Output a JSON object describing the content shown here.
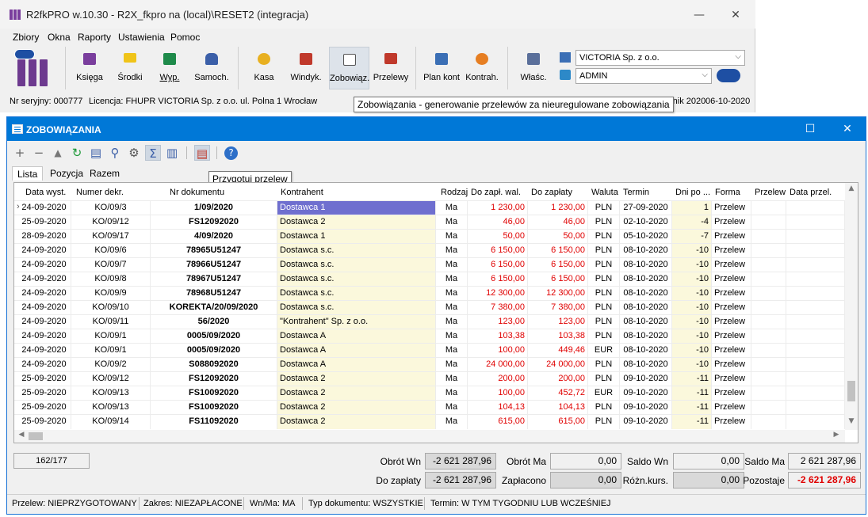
{
  "app": {
    "title": "R2fkPRO w.10.30 - R2X_fkpro na (local)\\RESET2 (integracja)",
    "minimize": "—",
    "close": "✕"
  },
  "menu": [
    "Zbiory",
    "Okna",
    "Raporty",
    "Ustawienia",
    "Pomoc"
  ],
  "toolbar": {
    "buttons": [
      "Księga",
      "Środki",
      "Wyp.",
      "Samoch.",
      "Kasa",
      "Windyk.",
      "Zobowiąz.",
      "Przelewy",
      "Plan kont",
      "Kontrah.",
      "Właśc."
    ],
    "company": "VICTORIA Sp. z o.o.",
    "user": "ADMIN",
    "combo_arrow": "⌵"
  },
  "statusline": {
    "serial": "Nr seryjny: 000777",
    "license": "Licencja: FHUPR VICTORIA Sp. z o.o. ul. Polna 1 Wrocław",
    "period": "rnik 2020",
    "date": "06-10-2020"
  },
  "tooltip_main": "Zobowiązania - generowanie przelewów za nieuregulowane zobowiązania",
  "tooltip_child": "Przygotuj przelew",
  "child": {
    "title": "ZOBOWIĄZANIA",
    "maximize": "☐",
    "close": "✕",
    "tabs": [
      "Lista",
      "Pozycja",
      "Razem"
    ]
  },
  "grid": {
    "columns": [
      "Data wyst.",
      "Numer dekr.",
      "Nr dokumentu",
      "Kontrahent",
      "Rodzaj",
      "Do zapł. wal.",
      "Do zapłaty",
      "Waluta",
      "Termin",
      "Dni po ...",
      "Forma",
      "Przelew",
      "Data przel."
    ],
    "rows": [
      [
        "24-09-2020",
        "KO/09/3",
        "1/09/2020",
        "Dostawca 1",
        "Ma",
        "1 230,00",
        "1 230,00",
        "PLN",
        "27-09-2020",
        "1",
        "Przelew"
      ],
      [
        "25-09-2020",
        "KO/09/12",
        "FS12092020",
        "Dostawca 2",
        "Ma",
        "46,00",
        "46,00",
        "PLN",
        "02-10-2020",
        "-4",
        "Przelew"
      ],
      [
        "28-09-2020",
        "KO/09/17",
        "4/09/2020",
        "Dostawca 1",
        "Ma",
        "50,00",
        "50,00",
        "PLN",
        "05-10-2020",
        "-7",
        "Przelew"
      ],
      [
        "24-09-2020",
        "KO/09/6",
        "78965U51247",
        "Dostawca s.c.",
        "Ma",
        "6 150,00",
        "6 150,00",
        "PLN",
        "08-10-2020",
        "-10",
        "Przelew"
      ],
      [
        "24-09-2020",
        "KO/09/7",
        "78966U51247",
        "Dostawca s.c.",
        "Ma",
        "6 150,00",
        "6 150,00",
        "PLN",
        "08-10-2020",
        "-10",
        "Przelew"
      ],
      [
        "24-09-2020",
        "KO/09/8",
        "78967U51247",
        "Dostawca s.c.",
        "Ma",
        "6 150,00",
        "6 150,00",
        "PLN",
        "08-10-2020",
        "-10",
        "Przelew"
      ],
      [
        "24-09-2020",
        "KO/09/9",
        "78968U51247",
        "Dostawca s.c.",
        "Ma",
        "12 300,00",
        "12 300,00",
        "PLN",
        "08-10-2020",
        "-10",
        "Przelew"
      ],
      [
        "24-09-2020",
        "KO/09/10",
        "KOREKTA/20/09/2020",
        "Dostawca s.c.",
        "Ma",
        "7 380,00",
        "7 380,00",
        "PLN",
        "08-10-2020",
        "-10",
        "Przelew"
      ],
      [
        "24-09-2020",
        "KO/09/11",
        "56/2020",
        "\"Kontrahent\" Sp. z o.o.",
        "Ma",
        "123,00",
        "123,00",
        "PLN",
        "08-10-2020",
        "-10",
        "Przelew"
      ],
      [
        "24-09-2020",
        "KO/09/1",
        "0005/09/2020",
        "Dostawca A",
        "Ma",
        "103,38",
        "103,38",
        "PLN",
        "08-10-2020",
        "-10",
        "Przelew"
      ],
      [
        "24-09-2020",
        "KO/09/1",
        "0005/09/2020",
        "Dostawca A",
        "Ma",
        "100,00",
        "449,46",
        "EUR",
        "08-10-2020",
        "-10",
        "Przelew"
      ],
      [
        "24-09-2020",
        "KO/09/2",
        "S088092020",
        "Dostawca A",
        "Ma",
        "24 000,00",
        "24 000,00",
        "PLN",
        "08-10-2020",
        "-10",
        "Przelew"
      ],
      [
        "25-09-2020",
        "KO/09/12",
        "FS12092020",
        "Dostawca 2",
        "Ma",
        "200,00",
        "200,00",
        "PLN",
        "09-10-2020",
        "-11",
        "Przelew"
      ],
      [
        "25-09-2020",
        "KO/09/13",
        "FS10092020",
        "Dostawca 2",
        "Ma",
        "100,00",
        "452,72",
        "EUR",
        "09-10-2020",
        "-11",
        "Przelew"
      ],
      [
        "25-09-2020",
        "KO/09/13",
        "FS10092020",
        "Dostawca 2",
        "Ma",
        "104,13",
        "104,13",
        "PLN",
        "09-10-2020",
        "-11",
        "Przelew"
      ],
      [
        "25-09-2020",
        "KO/09/14",
        "FS11092020",
        "Dostawca 2",
        "Ma",
        "615,00",
        "615,00",
        "PLN",
        "09-10-2020",
        "-11",
        "Przelew"
      ]
    ],
    "selected_row": 0
  },
  "totals": {
    "count": "162/177",
    "obrot_wn_label": "Obrót Wn",
    "obrot_wn": "-2 621 287,96",
    "obrot_ma_label": "Obrót Ma",
    "obrot_ma": "0,00",
    "saldo_wn_label": "Saldo Wn",
    "saldo_wn": "0,00",
    "saldo_ma_label": "Saldo Ma",
    "saldo_ma": "2 621 287,96",
    "do_zaplaty_label": "Do zapłaty",
    "do_zaplaty": "-2 621 287,96",
    "zaplacono_label": "Zapłacono",
    "zaplacono": "0,00",
    "roznica_label": "Różn.kurs.",
    "roznica": "0,00",
    "pozostaje_label": "Pozostaje",
    "pozostaje": "-2 621 287,96"
  },
  "bottom_status": {
    "przelew": "Przelew: NIEPRZYGOTOWANY",
    "zakres": "Zakres: NIEZAPŁACONE",
    "wnma": "Wn/Ma: MA",
    "typ": "Typ dokumentu: WSZYSTKIE",
    "termin": "Termin: W TYM TYGODNIU LUB WCZEŚNIEJ"
  },
  "colors": {
    "titlebar": "#0078d7",
    "kontrahent_bg": "#fbf8dc",
    "selection": "#6f6fcf",
    "negative": "#e00000"
  }
}
